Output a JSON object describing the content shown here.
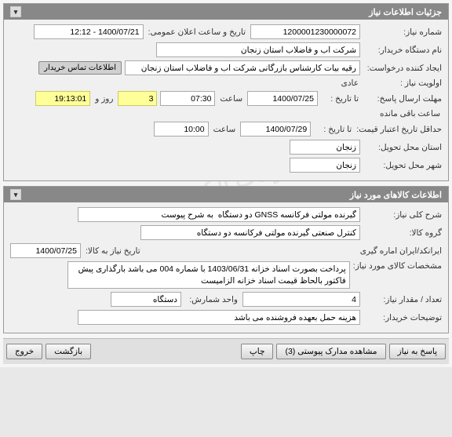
{
  "sections": {
    "need_info": {
      "title": "جزئیات اطلاعات نیاز",
      "fields": {
        "need_number_label": "شماره نیاز:",
        "need_number": "1200001230000072",
        "announce_label": "تاریخ و ساعت اعلان عمومی:",
        "announce_value": "1400/07/21 - 12:12",
        "buyer_label": "نام دستگاه خریدار:",
        "buyer_value": "شرکت آب و فاضلاب استان زنجان",
        "requester_label": "ایجاد کننده درخواست:",
        "requester_value": "رقیه بیات کارشناس بازرگانی شرکت آب و فاضلاب استان زنجان",
        "contact_btn": "اطلاعات تماس خریدار",
        "priority_label": "اولویت نیاز :",
        "priority_value": "عادی",
        "response_deadline_label": "مهلت ارسال پاسخ:",
        "to_date_label": "تا تاریخ :",
        "response_date": "1400/07/25",
        "time_label": "ساعت",
        "response_time": "07:30",
        "days_count": "3",
        "days_label": "روز و",
        "remain_time": "19:13:01",
        "remain_label": "ساعت باقی مانده",
        "min_valid_label": "حداقل تاریخ اعتبار قیمت:",
        "min_valid_date": "1400/07/29",
        "min_valid_time": "10:00",
        "delivery_province_label": "استان محل تحویل:",
        "delivery_province": "زنجان",
        "delivery_city_label": "شهر محل تحویل:",
        "delivery_city": "زنجان"
      }
    },
    "items_info": {
      "title": "اطلاعات کالاهای مورد نیاز",
      "fields": {
        "desc_label": "شرح کلی نیاز:",
        "desc_value": "گیرنده مولتی فرکانسه GNSS دو دستگاه  به شرح پیوست",
        "group_label": "گروه کالا:",
        "group_value": "کنترل صنعتی گیرنده مولتی فرکانسه دو دستگاه",
        "ref_label": "ایرانکد/ایران اماره گیری",
        "need_date_label": "تاریخ نیاز به کالا:",
        "need_date": "1400/07/25",
        "spec_label": "مشخصات کالای مورد نیاز:",
        "spec_value": "پرداخت بصورت اسناد خزانه 1403/06/31 با شماره 004 می باشد بارگذاری پیش فاکتور بالحاظ قیمت اسناد خزانه الزامیست",
        "qty_label": "تعداد / مقدار نیاز:",
        "qty_value": "4",
        "unit_label": "واحد شمارش:",
        "unit_value": "دستگاه",
        "buyer_notes_label": "توضیحات خریدار:",
        "buyer_notes": "هزینه حمل بعهده فروشنده می باشد"
      }
    }
  },
  "footer": {
    "reply": "پاسخ به نیاز",
    "attachments": "مشاهده مدارک پیوستی (3)",
    "print": "چاپ",
    "back": "بازگشت",
    "exit": "خروج"
  }
}
